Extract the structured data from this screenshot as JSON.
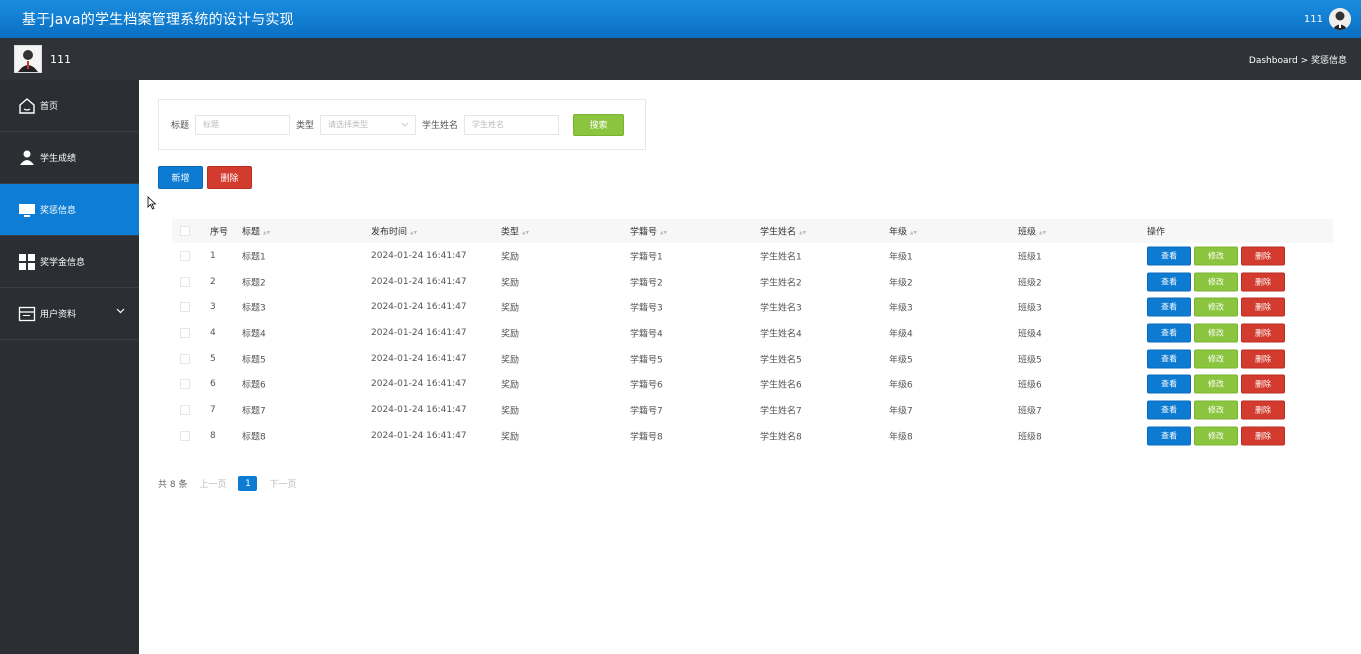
{
  "header": {
    "app_title": "基于Java的学生档案管理系统的设计与实现",
    "username": "111"
  },
  "subheader": {
    "username": "111",
    "breadcrumb": "Dashboard > 奖惩信息"
  },
  "sidebar": {
    "items": [
      {
        "label": "首页",
        "icon": "home-icon"
      },
      {
        "label": "学生成绩",
        "icon": "person-icon"
      },
      {
        "label": "奖惩信息",
        "icon": "monitor-icon"
      },
      {
        "label": "奖学金信息",
        "icon": "grid-icon"
      },
      {
        "label": "用户资料",
        "icon": "window-icon"
      }
    ]
  },
  "search": {
    "title_label": "标题",
    "title_placeholder": "标题",
    "type_label": "类型",
    "type_placeholder": "请选择类型",
    "name_label": "学生姓名",
    "name_placeholder": "学生姓名",
    "search_button": "搜索"
  },
  "actions": {
    "add_button": "新增",
    "delete_button": "删除"
  },
  "table": {
    "columns": [
      "序号",
      "标题",
      "发布时间",
      "类型",
      "学籍号",
      "学生姓名",
      "年级",
      "班级",
      "操作"
    ],
    "rows": [
      {
        "no": "1",
        "title": "标题1",
        "time": "2024-01-24 16:41:47",
        "type": "奖励",
        "sid": "学籍号1",
        "name": "学生姓名1",
        "grade": "年级1",
        "cls": "班级1"
      },
      {
        "no": "2",
        "title": "标题2",
        "time": "2024-01-24 16:41:47",
        "type": "奖励",
        "sid": "学籍号2",
        "name": "学生姓名2",
        "grade": "年级2",
        "cls": "班级2"
      },
      {
        "no": "3",
        "title": "标题3",
        "time": "2024-01-24 16:41:47",
        "type": "奖励",
        "sid": "学籍号3",
        "name": "学生姓名3",
        "grade": "年级3",
        "cls": "班级3"
      },
      {
        "no": "4",
        "title": "标题4",
        "time": "2024-01-24 16:41:47",
        "type": "奖励",
        "sid": "学籍号4",
        "name": "学生姓名4",
        "grade": "年级4",
        "cls": "班级4"
      },
      {
        "no": "5",
        "title": "标题5",
        "time": "2024-01-24 16:41:47",
        "type": "奖励",
        "sid": "学籍号5",
        "name": "学生姓名5",
        "grade": "年级5",
        "cls": "班级5"
      },
      {
        "no": "6",
        "title": "标题6",
        "time": "2024-01-24 16:41:47",
        "type": "奖励",
        "sid": "学籍号6",
        "name": "学生姓名6",
        "grade": "年级6",
        "cls": "班级6"
      },
      {
        "no": "7",
        "title": "标题7",
        "time": "2024-01-24 16:41:47",
        "type": "奖励",
        "sid": "学籍号7",
        "name": "学生姓名7",
        "grade": "年级7",
        "cls": "班级7"
      },
      {
        "no": "8",
        "title": "标题8",
        "time": "2024-01-24 16:41:47",
        "type": "奖励",
        "sid": "学籍号8",
        "name": "学生姓名8",
        "grade": "年级8",
        "cls": "班级8"
      }
    ],
    "row_actions": {
      "view": "查看",
      "edit": "修改",
      "delete": "删除"
    }
  },
  "pagination": {
    "total": "共 8 条",
    "prev": "上一页",
    "current": "1",
    "next": "下一页"
  },
  "colors": {
    "topbar": "#0a6fc2",
    "sidebar": "#2b2f33",
    "active": "#0d7dd6",
    "green": "#8bc53f",
    "red": "#d33b2e"
  }
}
